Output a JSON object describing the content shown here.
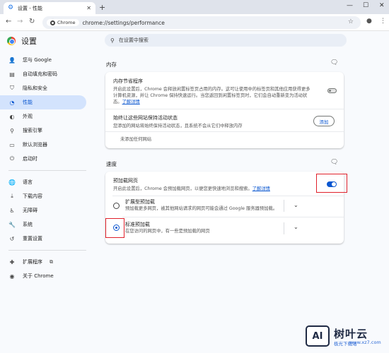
{
  "browser": {
    "tab_title": "设置 - 性能",
    "omnibox_chip": "Chrome",
    "url": "chrome://settings/performance",
    "icons": {
      "tab_favicon": "gear-icon",
      "tab_close": "close-icon",
      "new_tab": "plus-icon",
      "minimize": "minimize-icon",
      "maximize": "maximize-icon",
      "close_window": "close-icon",
      "back": "back-arrow-icon",
      "forward": "forward-arrow-icon",
      "reload": "reload-icon",
      "bookmark": "star-icon",
      "profile": "person-icon",
      "menu": "kebab-menu-icon"
    }
  },
  "sidebar": {
    "title": "设置",
    "items": [
      {
        "label": "您与 Google",
        "icon": "person-icon"
      },
      {
        "label": "自动填充和密码",
        "icon": "clipboard-icon"
      },
      {
        "label": "隐私和安全",
        "icon": "shield-icon"
      },
      {
        "label": "性能",
        "icon": "speedometer-icon",
        "active": true
      },
      {
        "label": "外观",
        "icon": "palette-icon"
      },
      {
        "label": "搜索引擎",
        "icon": "search-icon"
      },
      {
        "label": "默认浏览器",
        "icon": "browser-window-icon"
      },
      {
        "label": "启动时",
        "icon": "power-icon"
      },
      {
        "label": "语言",
        "icon": "globe-icon"
      },
      {
        "label": "下载内容",
        "icon": "download-icon"
      },
      {
        "label": "无障碍",
        "icon": "accessibility-icon"
      },
      {
        "label": "系统",
        "icon": "wrench-icon"
      },
      {
        "label": "重置设置",
        "icon": "reset-icon"
      },
      {
        "label": "扩展程序",
        "icon": "puzzle-icon"
      },
      {
        "label": "关于 Chrome",
        "icon": "chrome-logo-icon"
      }
    ]
  },
  "search": {
    "placeholder": "在设置中搜索"
  },
  "memory": {
    "heading": "内存",
    "saver_title": "内存节省程序",
    "saver_desc": "开启此设置后，Chrome 会释放闲置标签页占用的内存。这可让使用中的标签页和其他应用获得更多计算机资源，并让 Chrome 保持快速运行。当您返回到闲置标签页时，它们会自动重新变为活动状态。",
    "saver_link": "了解详情",
    "saver_on": false,
    "keep_title": "始终让这些网站保持活动状态",
    "keep_desc": "您添加的网站将始终保持活动状态，且系统不会从它们中释放内存",
    "add_button": "添加",
    "empty_text": "未添加任何网站"
  },
  "speed": {
    "heading": "速度",
    "preload_title": "预加载网页",
    "preload_desc": "开启此设置后，Chrome 会预加载网页，以便您更快速地浏览和搜索。",
    "preload_link": "了解详情",
    "preload_on": true,
    "options": [
      {
        "title": "扩展型预加载",
        "desc": "预加载更多网页，被其他网站请求的网页可能会通过 Google 服务器预加载。",
        "selected": false
      },
      {
        "title": "标准预加载",
        "desc": "在您访问的网页中，有一些是预加载的网页",
        "selected": true
      }
    ]
  },
  "watermark": {
    "badge": "AI",
    "name": "树叶云",
    "sub": "极光下载站",
    "url": "www.xz7.com"
  },
  "colors": {
    "accent": "#0b57d0",
    "highlight_box": "#e0202a",
    "active_nav_bg": "#d3e3fd"
  }
}
